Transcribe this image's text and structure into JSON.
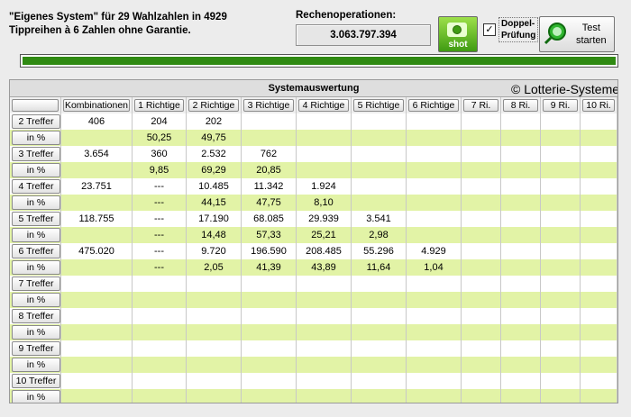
{
  "header": {
    "info_line1": "\"Eigenes System\" für 29 Wahlzahlen in 4929",
    "info_line2": "Tippreihen à 6 Zahlen ohne Garantie.",
    "ops_label": "Rechenoperationen:",
    "ops_value": "3.063.797.394",
    "shot_label": "shot",
    "double_check_label_1": "Doppel-",
    "double_check_label_2": "Prüfung",
    "double_check_checked": "✓",
    "test_label_1": "Test",
    "test_label_2": "starten",
    "progress_fraction": 1.0
  },
  "grid": {
    "title": "Systemauswertung",
    "watermark": "© Lotterie-Systeme-",
    "columns": [
      "",
      "Kombinationen",
      "1 Richtige",
      "2 Richtige",
      "3 Richtige",
      "4 Richtige",
      "5 Richtige",
      "6 Richtige",
      "7 Ri.",
      "8 Ri.",
      "9 Ri.",
      "10 Ri."
    ],
    "rows": [
      {
        "label": "2 Treffer",
        "cells": [
          "406",
          "204",
          "202",
          "",
          "",
          "",
          "",
          "",
          "",
          "",
          ""
        ]
      },
      {
        "label": "in %",
        "cells": [
          "",
          "50,25",
          "49,75",
          "",
          "",
          "",
          "",
          "",
          "",
          "",
          ""
        ]
      },
      {
        "label": "3 Treffer",
        "cells": [
          "3.654",
          "360",
          "2.532",
          "762",
          "",
          "",
          "",
          "",
          "",
          "",
          ""
        ]
      },
      {
        "label": "in %",
        "cells": [
          "",
          "9,85",
          "69,29",
          "20,85",
          "",
          "",
          "",
          "",
          "",
          "",
          ""
        ]
      },
      {
        "label": "4 Treffer",
        "cells": [
          "23.751",
          "---",
          "10.485",
          "11.342",
          "1.924",
          "",
          "",
          "",
          "",
          "",
          ""
        ]
      },
      {
        "label": "in %",
        "cells": [
          "",
          "---",
          "44,15",
          "47,75",
          "8,10",
          "",
          "",
          "",
          "",
          "",
          ""
        ]
      },
      {
        "label": "5 Treffer",
        "cells": [
          "118.755",
          "---",
          "17.190",
          "68.085",
          "29.939",
          "3.541",
          "",
          "",
          "",
          "",
          ""
        ]
      },
      {
        "label": "in %",
        "cells": [
          "",
          "---",
          "14,48",
          "57,33",
          "25,21",
          "2,98",
          "",
          "",
          "",
          "",
          ""
        ]
      },
      {
        "label": "6 Treffer",
        "cells": [
          "475.020",
          "---",
          "9.720",
          "196.590",
          "208.485",
          "55.296",
          "4.929",
          "",
          "",
          "",
          ""
        ]
      },
      {
        "label": "in %",
        "cells": [
          "",
          "---",
          "2,05",
          "41,39",
          "43,89",
          "11,64",
          "1,04",
          "",
          "",
          "",
          ""
        ]
      },
      {
        "label": "7 Treffer",
        "cells": [
          "",
          "",
          "",
          "",
          "",
          "",
          "",
          "",
          "",
          "",
          ""
        ]
      },
      {
        "label": "in %",
        "cells": [
          "",
          "",
          "",
          "",
          "",
          "",
          "",
          "",
          "",
          "",
          ""
        ]
      },
      {
        "label": "8 Treffer",
        "cells": [
          "",
          "",
          "",
          "",
          "",
          "",
          "",
          "",
          "",
          "",
          ""
        ]
      },
      {
        "label": "in %",
        "cells": [
          "",
          "",
          "",
          "",
          "",
          "",
          "",
          "",
          "",
          "",
          ""
        ]
      },
      {
        "label": "9 Treffer",
        "cells": [
          "",
          "",
          "",
          "",
          "",
          "",
          "",
          "",
          "",
          "",
          ""
        ]
      },
      {
        "label": "in %",
        "cells": [
          "",
          "",
          "",
          "",
          "",
          "",
          "",
          "",
          "",
          "",
          ""
        ]
      },
      {
        "label": "10 Treffer",
        "cells": [
          "",
          "",
          "",
          "",
          "",
          "",
          "",
          "",
          "",
          "",
          ""
        ]
      },
      {
        "label": "in %",
        "cells": [
          "",
          "",
          "",
          "",
          "",
          "",
          "",
          "",
          "",
          "",
          ""
        ]
      }
    ]
  }
}
